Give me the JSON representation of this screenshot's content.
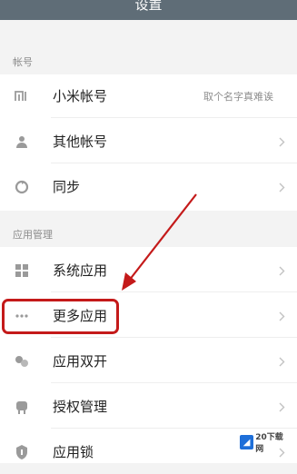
{
  "header": {
    "title": "设置"
  },
  "sections": {
    "account": {
      "title": "帐号",
      "items": [
        {
          "label": "小米帐号",
          "value": "取个名字真难诶",
          "icon": "mi-logo-icon"
        },
        {
          "label": "其他帐号",
          "icon": "person-icon"
        },
        {
          "label": "同步",
          "icon": "sync-icon"
        }
      ]
    },
    "apps": {
      "title": "应用管理",
      "items": [
        {
          "label": "系统应用",
          "icon": "grid-icon"
        },
        {
          "label": "更多应用",
          "icon": "more-dots-icon"
        },
        {
          "label": "应用双开",
          "icon": "dual-app-icon"
        },
        {
          "label": "授权管理",
          "icon": "permission-icon"
        },
        {
          "label": "应用锁",
          "icon": "app-lock-icon"
        }
      ]
    }
  },
  "annotation": {
    "highlight_color": "#c41a1a"
  },
  "watermark": {
    "logo_text": "◢",
    "text": "20下载网"
  }
}
